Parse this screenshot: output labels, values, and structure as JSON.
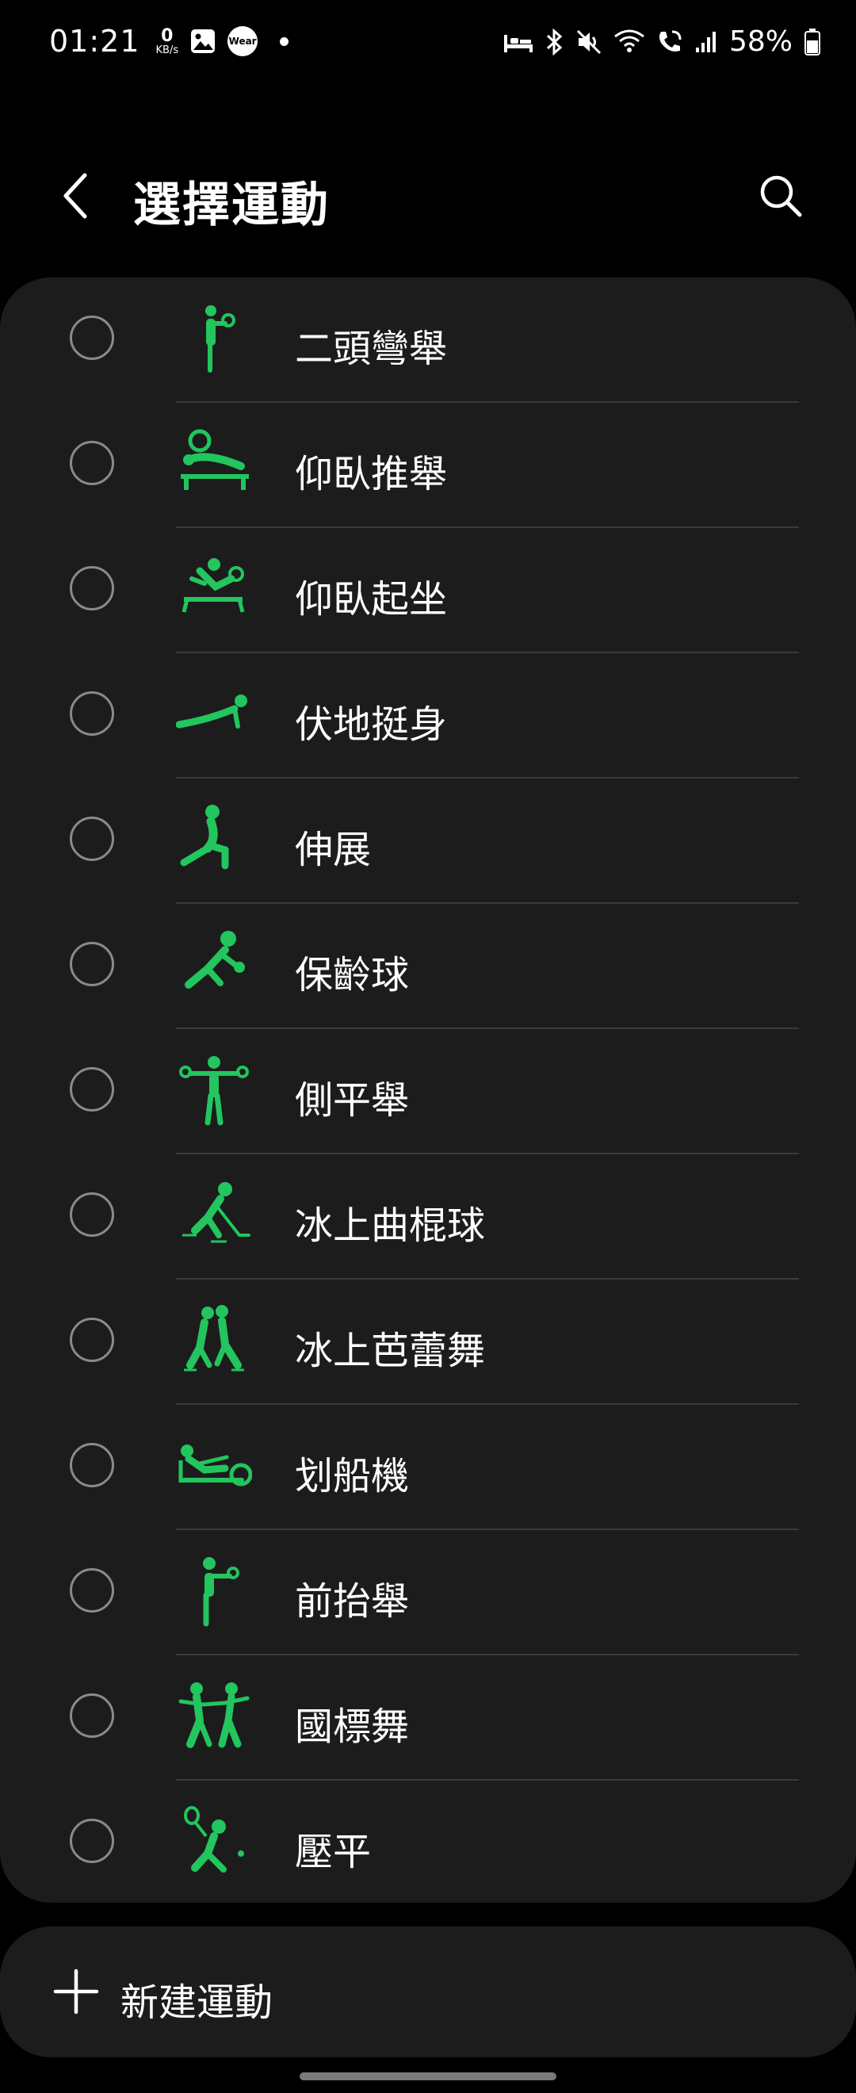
{
  "status_bar": {
    "time": "01:21",
    "net_speed_value": "0",
    "net_speed_unit": "KB/s",
    "wear_badge": "Wear",
    "battery": "58%"
  },
  "header": {
    "title": "選擇運動"
  },
  "exercises": [
    {
      "label": "二頭彎舉",
      "icon": "biceps-curl-icon"
    },
    {
      "label": "仰臥推舉",
      "icon": "bench-press-icon"
    },
    {
      "label": "仰臥起坐",
      "icon": "sit-up-icon"
    },
    {
      "label": "伏地挺身",
      "icon": "push-up-icon"
    },
    {
      "label": "伸展",
      "icon": "stretching-icon"
    },
    {
      "label": "保齡球",
      "icon": "bowling-icon"
    },
    {
      "label": "側平舉",
      "icon": "lateral-raise-icon"
    },
    {
      "label": "冰上曲棍球",
      "icon": "ice-hockey-icon"
    },
    {
      "label": "冰上芭蕾舞",
      "icon": "figure-skating-icon"
    },
    {
      "label": "划船機",
      "icon": "rowing-machine-icon"
    },
    {
      "label": "前抬舉",
      "icon": "front-raise-icon"
    },
    {
      "label": "國標舞",
      "icon": "ballroom-dance-icon"
    },
    {
      "label": "壓平",
      "icon": "squash-icon"
    }
  ],
  "add_button": {
    "label": "新建運動"
  },
  "colors": {
    "accent": "#22c55e",
    "background": "#000000",
    "card": "#1c1c1c",
    "divider": "#3a3a3a"
  }
}
